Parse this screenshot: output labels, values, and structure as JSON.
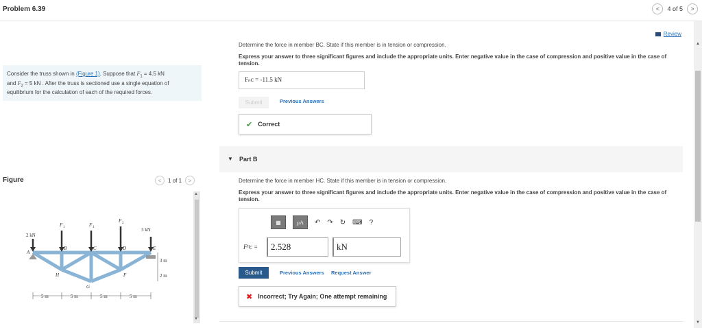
{
  "header": {
    "title": "Problem 6.39",
    "page_text": "4 of 5",
    "prev": "<",
    "next": ">"
  },
  "problem": {
    "line1_pre": "Consider the truss shown in ",
    "figure_link": "(Figure 1)",
    "line1_mid": ". Suppose that ",
    "f1_sym": "F",
    "f1_sub": "1",
    "line1_val": " = 4.5  kN",
    "line2_pre": "and ",
    "f2_sym": "F",
    "f2_sub": "2",
    "line2_rest": " = 5  kN . After the truss is sectioned use a single equation of",
    "line3": "equilibrium for the calculation of each of the required forces."
  },
  "figure": {
    "label": "Figure",
    "page_text": "1 of 1",
    "prev": "<",
    "next": ">",
    "labels": {
      "load_a": "2 kN",
      "load_e": "3 kN",
      "f1": "F",
      "f1_sub": "1",
      "f2": "F",
      "f2_sub": "2",
      "nA": "A",
      "nB": "B",
      "nC": "C",
      "nD": "D",
      "nE": "E",
      "nF": "F",
      "nG": "G",
      "nH": "H",
      "dim_3m": "3 m",
      "dim_2m": "2 m",
      "s1": "5 m",
      "s2": "5 m",
      "s3": "5 m",
      "s4": "5 m"
    }
  },
  "review": {
    "label": "Review"
  },
  "partA": {
    "question": "Determine the force in member BC. State if this member is in tension or compression.",
    "instruction": "Express your answer to three significant figures and include the appropriate units. Enter negative value in the case of compression and positive value in the case of tension.",
    "answer": "Fₙᴄ = -11.5 kN",
    "submit": "Submit",
    "previous_answers": "Previous Answers",
    "feedback": "Correct"
  },
  "partB": {
    "caret": "▼",
    "title": "Part B",
    "question": "Determine the force in member HC. State if this member is in tension or compression.",
    "instruction": "Express your answer to three significant figures and include the appropriate units. Enter negative value in the case of compression and positive value in the case of tension.",
    "eq_label": "Fᴴᴄ =",
    "value": "2.528",
    "unit": "kN",
    "toolbar": {
      "mu_label": "μA",
      "help": "?"
    },
    "submit": "Submit",
    "previous_answers": "Previous Answers",
    "request_answer": "Request Answer",
    "feedback": "Incorrect; Try Again; One attempt remaining"
  },
  "colors": {
    "link": "#2a6fb5",
    "submit": "#2a5a8c",
    "correct": "#3c9a3c",
    "incorrect": "#dd2222",
    "truss": "#8ab4d6"
  }
}
